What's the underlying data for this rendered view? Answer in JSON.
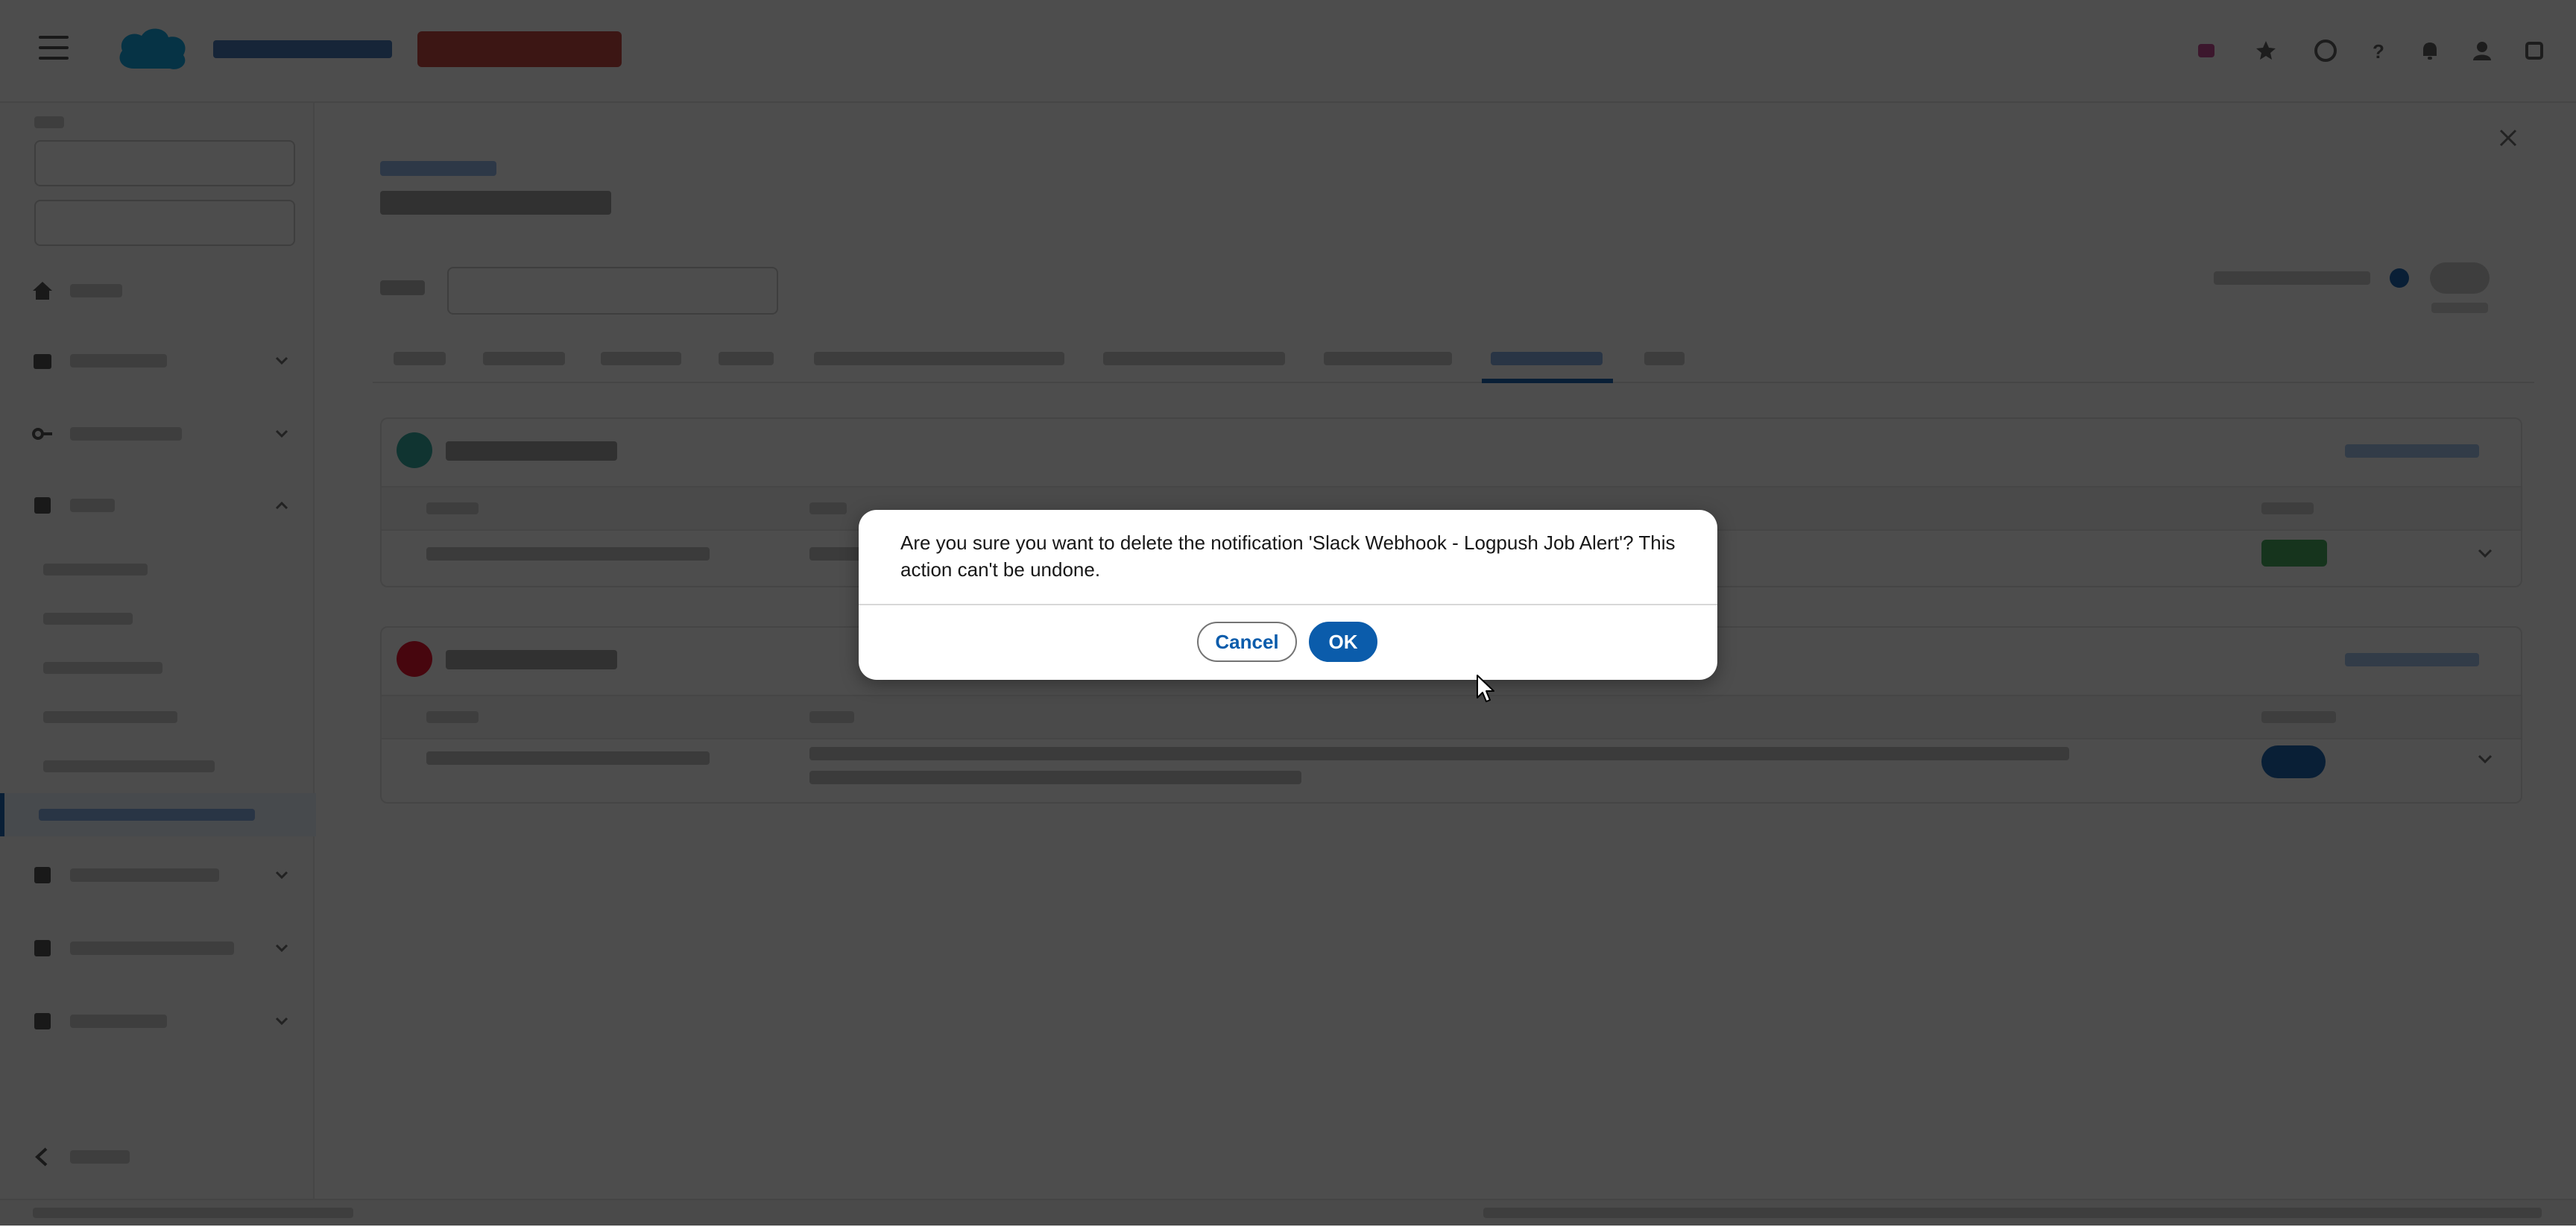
{
  "dialog": {
    "message": "Are you sure you want to delete the notification 'Slack Webhook - Logpush Job Alert'? This action can't be undone.",
    "cancel_label": "Cancel",
    "ok_label": "OK"
  },
  "icons": {
    "menu": "hamburger-icon",
    "logo": "cloud-logo",
    "header": [
      "flag-icon",
      "star-icon",
      "grid-icon",
      "help-icon",
      "bell-icon",
      "user-icon",
      "setup-icon"
    ],
    "cursor": "mouse-pointer"
  },
  "colors": {
    "brand_blue": "#0b5cab",
    "env_badge_red": "#c23934",
    "overlay": "rgba(8,8,8,0.72)"
  }
}
